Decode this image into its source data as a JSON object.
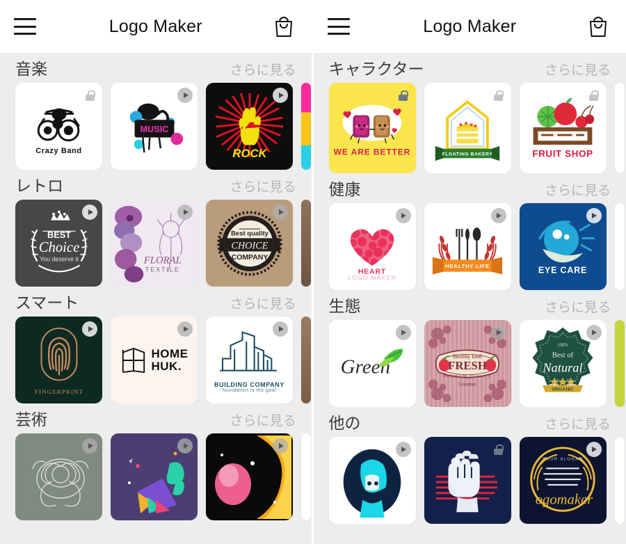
{
  "app": {
    "title": "Logo Maker",
    "menu_icon": "hamburger-menu-icon",
    "bag_icon": "shopping-bag-icon"
  },
  "more_label": "さらに見る",
  "left_screen": {
    "sections": [
      {
        "title": "音楽",
        "more": "さらに見る",
        "cards": [
          {
            "name": "crazy-band",
            "label": "Crazy Band",
            "badge": "lock",
            "bg": "#ffffff",
            "fg": "#111111"
          },
          {
            "name": "music-splash",
            "label": "MUSIC",
            "badge": "play",
            "bg": "#ffffff",
            "fg": "#e81fa0"
          },
          {
            "name": "rock",
            "label": "ROCK",
            "badge": "play",
            "bg": "#0d0d0d",
            "fg": "#f2e10c"
          },
          {
            "name": "partial-next",
            "label": "",
            "badge": "none",
            "bg": "#ff2b9d",
            "fg": "#ffffff"
          }
        ]
      },
      {
        "title": "レトロ",
        "more": "さらに見る",
        "cards": [
          {
            "name": "best-choice",
            "label": "Choice",
            "badge": "play",
            "bg": "#474747",
            "fg": "#ffffff"
          },
          {
            "name": "floral-textile",
            "label": "FLORAL",
            "badge": "play",
            "bg": "#efe7ef",
            "fg": "#8d4f8f"
          },
          {
            "name": "choice-company",
            "label": "CHOICE",
            "badge": "play",
            "bg": "#b99c7c",
            "fg": "#241f1c"
          },
          {
            "name": "partial-next",
            "label": "",
            "badge": "none",
            "bg": "#6d5441",
            "fg": "#ffffff"
          }
        ]
      },
      {
        "title": "スマート",
        "more": "さらに見る",
        "cards": [
          {
            "name": "fingerprint",
            "label": "FINGERPRINT",
            "badge": "play",
            "bg": "#0d2a22",
            "fg": "#c98b62"
          },
          {
            "name": "home-huk",
            "label": "HOME HUK.",
            "badge": "play",
            "bg": "#fbf4ef",
            "fg": "#1a1a1a"
          },
          {
            "name": "building-company",
            "label": "BUILDING COMPANY",
            "badge": "play",
            "bg": "#ffffff",
            "fg": "#1c4e63"
          },
          {
            "name": "partial-next",
            "label": "",
            "badge": "none",
            "bg": "#8a6a52",
            "fg": "#ffffff"
          }
        ]
      },
      {
        "title": "芸術",
        "more": "さらに見る",
        "cards": [
          {
            "name": "grey-flower",
            "label": "",
            "badge": "play",
            "bg": "#7f8a80",
            "fg": "#e8e8e8"
          },
          {
            "name": "purple-abstract",
            "label": "",
            "badge": "play",
            "bg": "#4a3e72",
            "fg": "#37e0c0"
          },
          {
            "name": "neon-portrait",
            "label": "",
            "badge": "play",
            "bg": "#0a0a0a",
            "fg": "#f7a81b"
          },
          {
            "name": "partial-next",
            "label": "",
            "badge": "none",
            "bg": "#ffffff",
            "fg": "#ffffff"
          }
        ]
      }
    ]
  },
  "right_screen": {
    "sections": [
      {
        "title": "キャラクター",
        "more": "さらに見る",
        "cards": [
          {
            "name": "we-are-better",
            "label": "WE ARE BETTER",
            "badge": "lock",
            "bg": "#fbe54d",
            "fg": "#d81b3c"
          },
          {
            "name": "floating-bakery",
            "label": "FLOATING BAKERY",
            "badge": "lock",
            "bg": "#ffffff",
            "fg": "#2e7d32"
          },
          {
            "name": "fruit-shop",
            "label": "FRUIT SHOP",
            "badge": "lock",
            "bg": "#ffffff",
            "fg": "#e2183f"
          },
          {
            "name": "partial-next",
            "label": "",
            "badge": "none",
            "bg": "#ffffff",
            "fg": "#ffffff"
          }
        ]
      },
      {
        "title": "健康",
        "more": "さらに見る",
        "cards": [
          {
            "name": "heart-logo-maker",
            "label": "HEART",
            "sublabel": "LOGO MAKER",
            "badge": "play",
            "bg": "#ffffff",
            "fg": "#e8325c"
          },
          {
            "name": "healthy-life",
            "label": "HEALTHY LIFE",
            "badge": "play",
            "bg": "#ffffff",
            "fg": "#f28b21"
          },
          {
            "name": "eye-care",
            "label": "EYE CARE",
            "badge": "play",
            "bg": "#0e4b8f",
            "fg": "#ffffff"
          },
          {
            "name": "partial-next",
            "label": "",
            "badge": "none",
            "bg": "#ffffff",
            "fg": "#ffffff"
          }
        ]
      },
      {
        "title": "生態",
        "more": "さらに見る",
        "cards": [
          {
            "name": "green",
            "label": "Green",
            "badge": "play",
            "bg": "#ffffff",
            "fg": "#2b2b2b"
          },
          {
            "name": "fresh-healthy-food",
            "label": "FRESH",
            "badge": "play",
            "bg": "#d7a3a8",
            "fg": "#7d2740"
          },
          {
            "name": "best-of-natural",
            "label": "Natural",
            "badge": "play",
            "bg": "#ffffff",
            "fg": "#1f5040"
          },
          {
            "name": "partial-next",
            "label": "",
            "badge": "none",
            "bg": "#c3d53a",
            "fg": "#ffffff"
          }
        ]
      },
      {
        "title": "他の",
        "more": "さらに見る",
        "cards": [
          {
            "name": "hooded-character",
            "label": "",
            "badge": "play",
            "bg": "#ffffff",
            "fg": "#1ad6e8"
          },
          {
            "name": "red-fist",
            "label": "",
            "badge": "lock",
            "bg": "#12204a",
            "fg": "#e0243a"
          },
          {
            "name": "logomaker-badge",
            "label": "ogomaker",
            "badge": "play",
            "bg": "#0d1430",
            "fg": "#e8b83a"
          },
          {
            "name": "partial-next",
            "label": "",
            "badge": "none",
            "bg": "#ffffff",
            "fg": "#ffffff"
          }
        ]
      }
    ]
  }
}
